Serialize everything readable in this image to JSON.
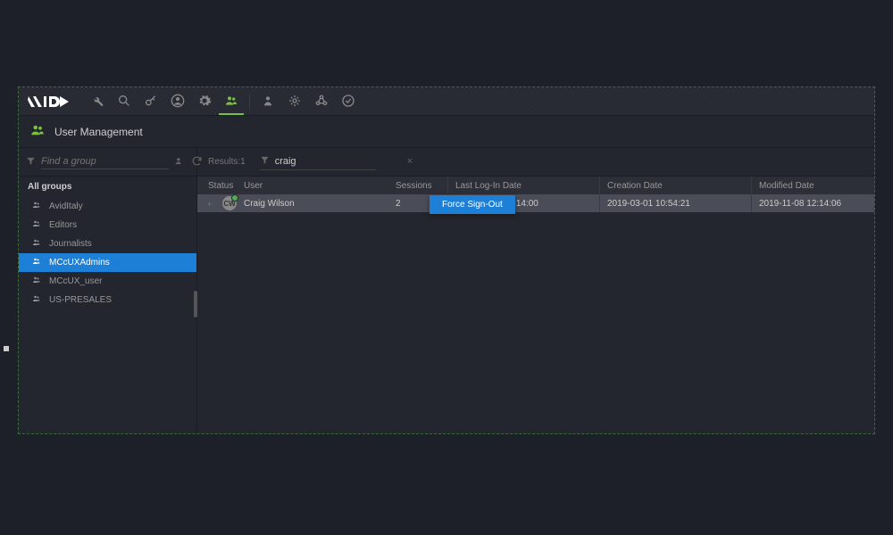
{
  "page_title": "User Management",
  "sidebar": {
    "search_placeholder": "Find a group",
    "all_groups_label": "All groups",
    "groups": [
      {
        "label": "AvidItaly"
      },
      {
        "label": "Editors"
      },
      {
        "label": "Journalists"
      },
      {
        "label": "MCcUXAdmins",
        "selected": true
      },
      {
        "label": "MCcUX_user"
      },
      {
        "label": "US-PRESALES"
      }
    ]
  },
  "content": {
    "results_label": "Results:1",
    "search_value": "craig",
    "columns": {
      "status": "Status",
      "user": "User",
      "sessions": "Sessions",
      "login": "Last Log-In Date",
      "created": "Creation Date",
      "modified": "Modified Date"
    },
    "rows": [
      {
        "initials": "CW",
        "user": "Craig Wilson",
        "sessions": "2",
        "login": "2020-06-10 10:14:00",
        "created": "2019-03-01 10:54:21",
        "modified": "2019-11-08 12:14:06"
      }
    ],
    "context_menu": {
      "force_sign_out": "Force Sign-Out"
    }
  }
}
